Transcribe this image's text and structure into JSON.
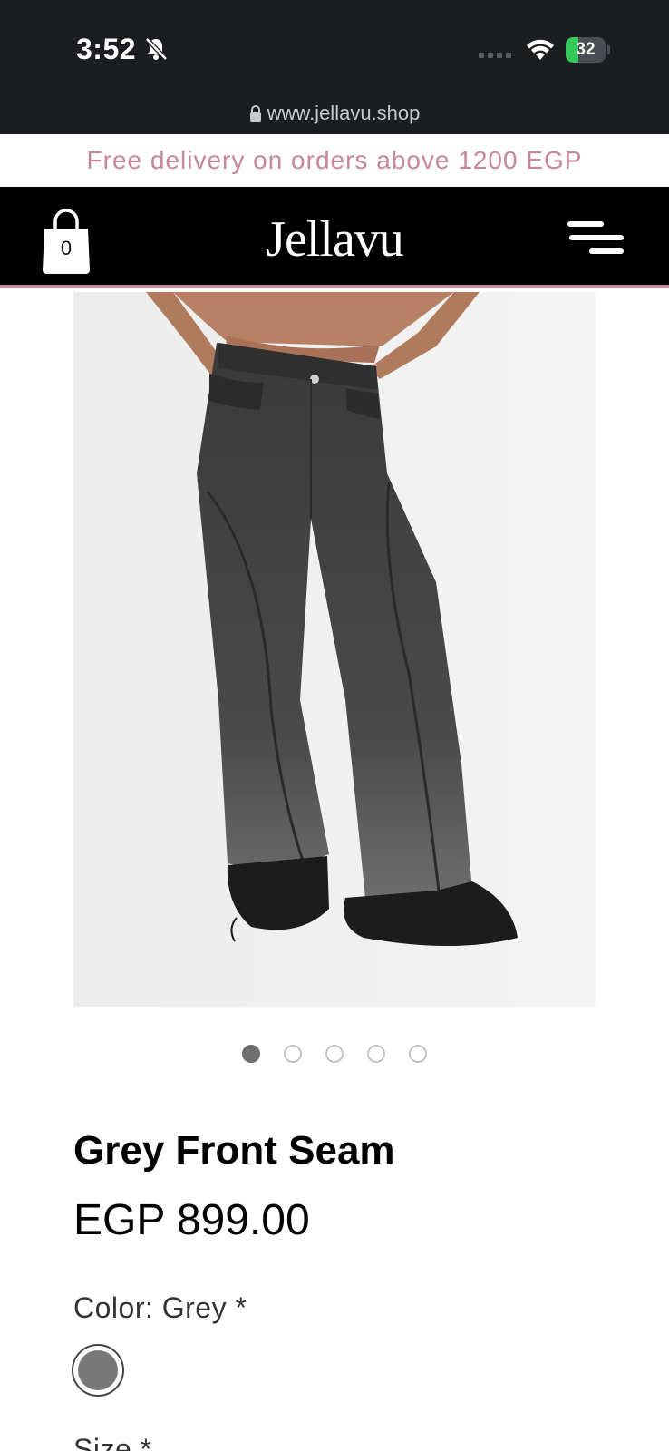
{
  "status_bar": {
    "time": "3:52",
    "battery_percent": "32",
    "battery_level": 0.32,
    "url": "www.jellavu.shop"
  },
  "promo_banner": {
    "text": "Free delivery on orders above 1200 EGP",
    "color": "#c8869a"
  },
  "header": {
    "logo": "Jellavu",
    "cart_count": "0"
  },
  "gallery": {
    "image_alt": "Grey front seam jeans",
    "total_slides": 5,
    "active_slide": 1
  },
  "product": {
    "title": "Grey Front Seam",
    "price": "EGP 899.00",
    "color_label": "Color: Grey *",
    "selected_color": "#787878",
    "size_label": "Size *"
  },
  "icons": [
    "bell-slash-icon",
    "signal-icon",
    "wifi-icon",
    "battery-icon",
    "lock-icon",
    "shopping-bag-icon",
    "menu-icon"
  ]
}
